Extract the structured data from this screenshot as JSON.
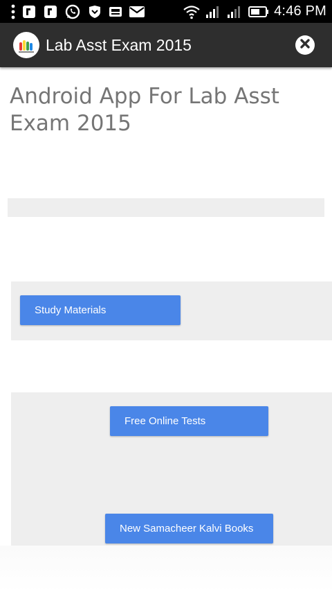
{
  "status_bar": {
    "time": "4:46 PM",
    "icons": [
      "overflow-menu-icon",
      "notification-icon",
      "notification-icon",
      "whatsapp-icon",
      "shield-icon",
      "news-icon",
      "mail-icon",
      "wifi-icon",
      "signal-icon",
      "signal-icon",
      "battery-icon"
    ]
  },
  "action_bar": {
    "title": "Lab Asst Exam 2015",
    "logo_icon": "app-logo-icon",
    "close_icon": "close-icon"
  },
  "main": {
    "heading": "Android App For Lab Asst Exam 2015",
    "buttons": {
      "study": "Study Materials",
      "tests": "Free Online Tests",
      "books": "New Samacheer Kalvi Books"
    }
  },
  "colors": {
    "status_bar": "#000000",
    "action_bar": "#2e2e2e",
    "button": "#4a86e8",
    "panel": "#eeeeee",
    "heading": "#757575"
  }
}
